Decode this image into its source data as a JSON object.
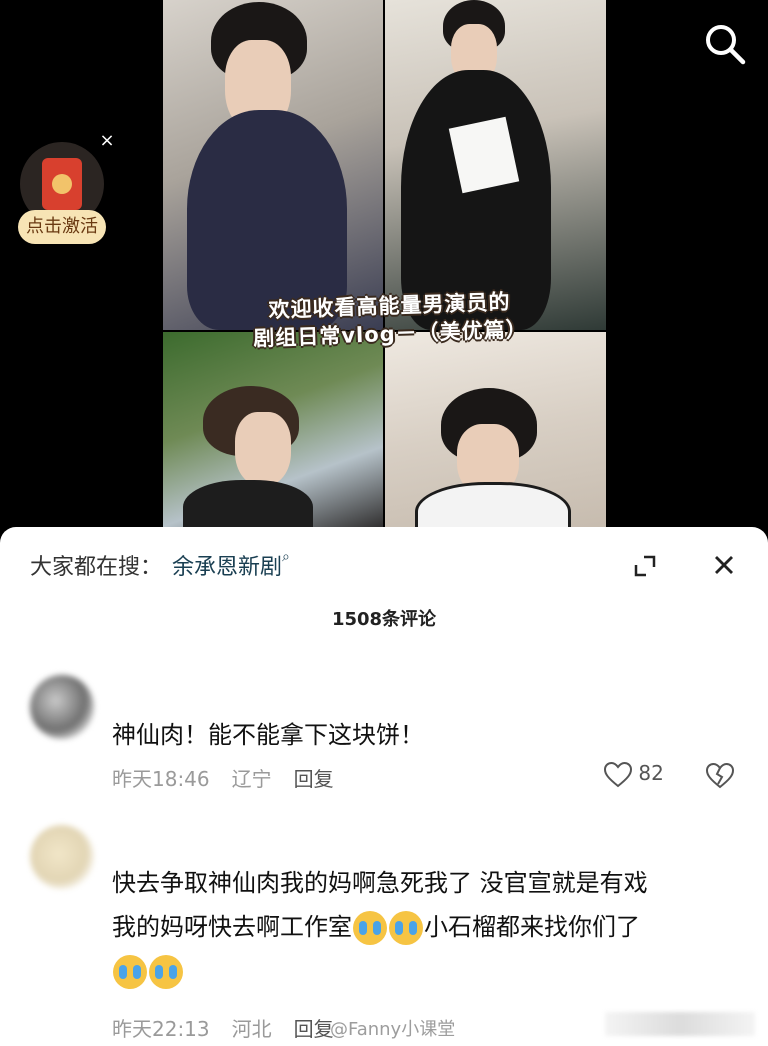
{
  "video": {
    "overlay_title_line1": "欢迎收看高能量男演员的",
    "overlay_title_line2": "剧组日常vlog－（美优篇）"
  },
  "red_packet": {
    "label": "点击激活",
    "close": "×"
  },
  "sheet": {
    "hot_search_prefix": "大家都在搜：",
    "hot_search_keyword": "余承恩新剧",
    "comment_count": "1508条评论"
  },
  "comments": [
    {
      "text": "神仙肉！能不能拿下这块饼！",
      "time": "昨天18:46",
      "location": "辽宁",
      "reply_label": "回复",
      "likes": "82"
    },
    {
      "text_line1": "快去争取神仙肉我的妈啊急死我了 没官宣就是有戏",
      "text_line2a": "我的妈呀快去啊工作室",
      "text_line2b": "小石榴都来找你们了",
      "time": "昨天22:13",
      "location": "河北",
      "reply_label": "回复"
    }
  ],
  "watermark": "@Fanny小课堂",
  "icons": {
    "search": "search-icon",
    "expand": "expand-icon",
    "close": "close-icon",
    "like": "heart-icon",
    "dislike": "broken-heart-icon",
    "crying_emoji": "crying-emoji-icon"
  }
}
